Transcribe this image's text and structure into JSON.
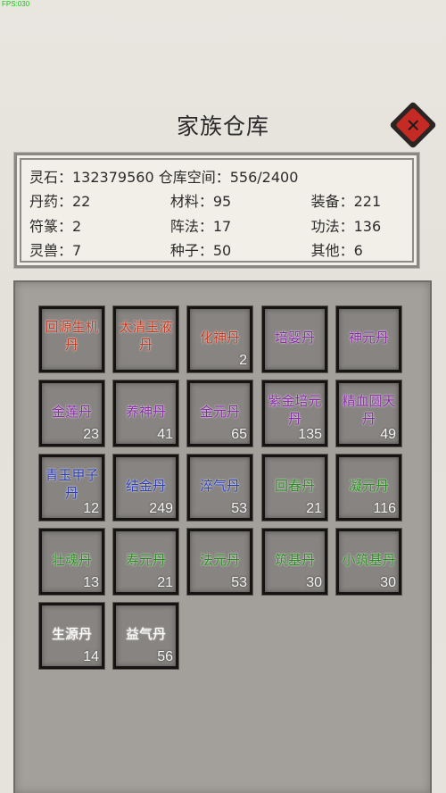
{
  "fps": "FPS:030",
  "title": "家族仓库",
  "stats": {
    "spirit_stone": "灵石：132379560",
    "storage": "仓库空间：556/2400",
    "rows": [
      [
        "丹药：22",
        "材料：95",
        "装备：221"
      ],
      [
        "符篆：2",
        "阵法：17",
        "功法：136"
      ],
      [
        "灵兽：7",
        "种子：50",
        "其他：6"
      ]
    ]
  },
  "colors": {
    "orange": "#c8381e",
    "purple": "#8a2ba6",
    "blue": "#2d3db4",
    "green": "#2b8a1f",
    "white": "#ffffff"
  },
  "items": [
    {
      "name": "回源生机丹",
      "count": "",
      "color": "#c8381e"
    },
    {
      "name": "太清玉液丹",
      "count": "",
      "color": "#c8381e"
    },
    {
      "name": "化神丹",
      "count": "2",
      "color": "#c8381e"
    },
    {
      "name": "培婴丹",
      "count": "",
      "color": "#8a2ba6"
    },
    {
      "name": "神元丹",
      "count": "",
      "color": "#8a2ba6"
    },
    {
      "name": "金莲丹",
      "count": "23",
      "color": "#8a2ba6"
    },
    {
      "name": "养神丹",
      "count": "41",
      "color": "#8a2ba6"
    },
    {
      "name": "金元丹",
      "count": "65",
      "color": "#8a2ba6"
    },
    {
      "name": "紫金培元丹",
      "count": "135",
      "color": "#8a2ba6"
    },
    {
      "name": "精血圆天丹",
      "count": "49",
      "color": "#8a2ba6"
    },
    {
      "name": "青玉甲子丹",
      "count": "12",
      "color": "#2d3db4"
    },
    {
      "name": "结金丹",
      "count": "249",
      "color": "#2d3db4"
    },
    {
      "name": "淬气丹",
      "count": "53",
      "color": "#2d3db4"
    },
    {
      "name": "回春丹",
      "count": "21",
      "color": "#2b8a1f"
    },
    {
      "name": "凝元丹",
      "count": "116",
      "color": "#2b8a1f"
    },
    {
      "name": "壮魂丹",
      "count": "13",
      "color": "#2b8a1f"
    },
    {
      "name": "寿元丹",
      "count": "21",
      "color": "#2b8a1f"
    },
    {
      "name": "法元丹",
      "count": "53",
      "color": "#2b8a1f"
    },
    {
      "name": "筑基丹",
      "count": "30",
      "color": "#2b8a1f"
    },
    {
      "name": "小筑基丹",
      "count": "30",
      "color": "#2b8a1f"
    },
    {
      "name": "生源丹",
      "count": "14",
      "color": "#ffffff"
    },
    {
      "name": "益气丹",
      "count": "56",
      "color": "#ffffff"
    }
  ]
}
